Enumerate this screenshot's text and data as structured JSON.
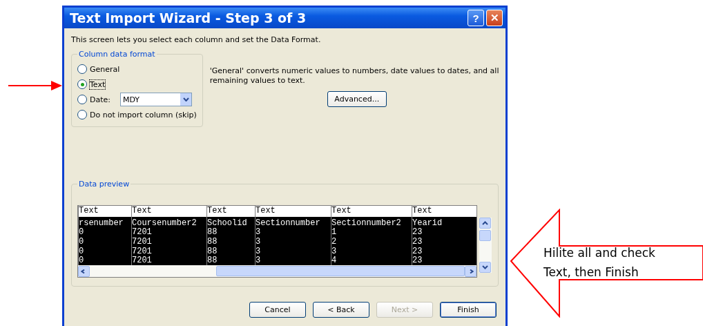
{
  "window": {
    "title": "Text Import Wizard - Step 3 of 3",
    "title_buttons": [
      {
        "kind": "help",
        "label": "?"
      },
      {
        "kind": "close",
        "label": "✕"
      }
    ]
  },
  "intro": "This screen lets you select each column and set the Data Format.",
  "column_data_format": {
    "legend": "Column data format",
    "options": [
      {
        "label": "General",
        "selected": false
      },
      {
        "label": "Text",
        "selected": true
      },
      {
        "label": "Date:",
        "selected": false,
        "kind": "date",
        "value": "MDY"
      },
      {
        "label": "Do not import column (skip)",
        "selected": false
      }
    ]
  },
  "description": "'General' converts numeric values to numbers, date values to dates, and all remaining values to text.",
  "advanced_button": "Advanced...",
  "data_preview": {
    "legend": "Data preview",
    "columns": [
      {
        "format": "Text",
        "cells": [
          "rsenumber",
          "0",
          "0",
          "0",
          "0"
        ]
      },
      {
        "format": "Text",
        "cells": [
          "Coursenumber2",
          "7201",
          "7201",
          "7201",
          "7201"
        ]
      },
      {
        "format": "Text",
        "cells": [
          "Schoolid",
          "88",
          "88",
          "88",
          "88"
        ]
      },
      {
        "format": "Text",
        "cells": [
          "Sectionnumber",
          "3",
          "3",
          "3",
          "3"
        ]
      },
      {
        "format": "Text",
        "cells": [
          "Sectionnumber2",
          "1",
          "2",
          "3",
          "4"
        ]
      },
      {
        "format": "Text",
        "cells": [
          "Yearid",
          "23",
          "23",
          "23",
          "23"
        ]
      }
    ]
  },
  "buttons": [
    {
      "label": "Cancel",
      "disabled": false,
      "default": false
    },
    {
      "label": "< Back",
      "disabled": false,
      "default": false
    },
    {
      "label": "Next >",
      "disabled": true,
      "default": false
    },
    {
      "label": "Finish",
      "disabled": false,
      "default": true
    }
  ],
  "callout": "Hilite all and check Text, then Finish"
}
